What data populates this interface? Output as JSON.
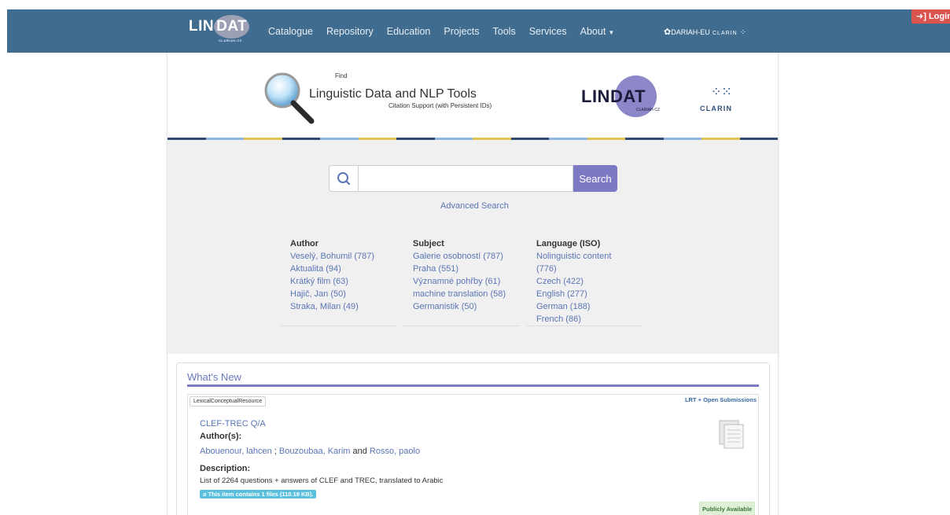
{
  "navbar": {
    "logo": {
      "text_before": "LIN",
      "text_circle": "DAT",
      "sub": "CLARIAH-CZ"
    },
    "items": [
      {
        "label": "Catalogue"
      },
      {
        "label": "Repository"
      },
      {
        "label": "Education"
      },
      {
        "label": "Projects"
      },
      {
        "label": "Tools"
      },
      {
        "label": "Services"
      },
      {
        "label": "About"
      }
    ],
    "dariah": "DARIAH-EU",
    "clarin": "CLARIN",
    "login": "Login"
  },
  "banner": {
    "find": "Find",
    "title": "Linguistic Data and NLP Tools",
    "citation": "Citation Support (with Persistent IDs)",
    "lindat_before": "LIN",
    "lindat_circle": "DAT",
    "lindat_sub": "CLARIAH-CZ",
    "clarin": "CLARIN"
  },
  "stripe_colors": [
    "#2f4a73",
    "#8fb6e0",
    "#e3c351",
    "#2f4a73",
    "#8fb6e0",
    "#e3c351",
    "#2f4a73",
    "#8fb6e0",
    "#e3c351",
    "#2f4a73",
    "#8fb6e0",
    "#e3c351",
    "#2f4a73",
    "#8fb6e0",
    "#e3c351",
    "#2f4a73"
  ],
  "search": {
    "placeholder": "",
    "button": "Search",
    "advanced": "Advanced Search"
  },
  "facets": [
    {
      "heading": "Author",
      "values": [
        "Veselý, Bohumil (787)",
        "Aktualita (94)",
        "Krátký film (63)",
        "Hajič, Jan (50)",
        "Straka, Milan (49)"
      ]
    },
    {
      "heading": "Subject",
      "values": [
        "Galerie osobností (787)",
        "Praha (551)",
        "Významné pohřby (61)",
        "machine translation (58)",
        "Germanistik (50)"
      ]
    },
    {
      "heading": "Language (ISO)",
      "values": [
        "Nolinguistic content",
        "(776)",
        "Czech (422)",
        "English (277)",
        "German (188)",
        "French (86)"
      ]
    }
  ],
  "whats_new": {
    "title": "What's New",
    "item": {
      "type": "LexicalConceptualResource",
      "license_label": "LRT + Open Submissions",
      "title": "CLEF-TREC Q/A",
      "authors_label": "Author(s):",
      "author_1": "Abouenour, lahcen",
      "sep_1": " ; ",
      "author_2": "Bouzoubaa, Karim",
      "sep_2": " and ",
      "author_3": "Rosso, paolo",
      "description_label": "Description:",
      "description": "List of 2264 questions + answers of CLEF and TREC, translated to Arabic",
      "files": "This item contains 1 files (110.19 KB).",
      "availability": "Publicly Available"
    }
  }
}
